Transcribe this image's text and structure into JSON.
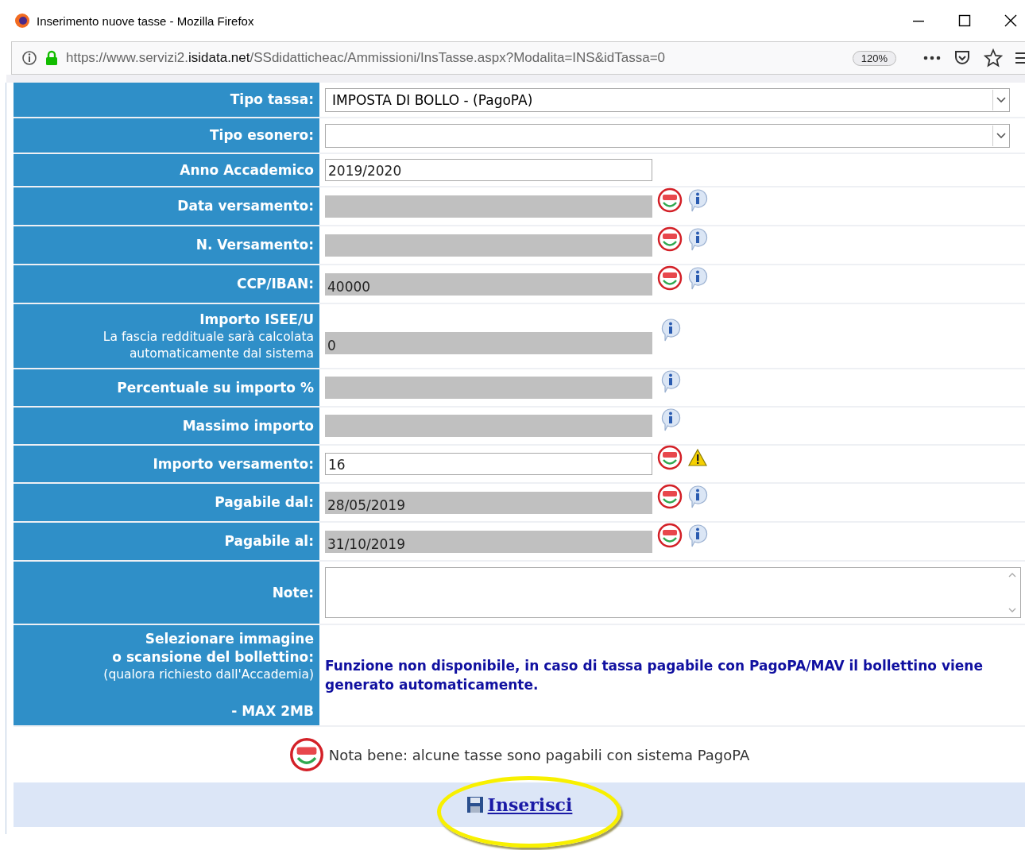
{
  "window": {
    "title": "Inserimento nuove tasse - Mozilla Firefox",
    "url_prefix": "https://www.servizi2.",
    "url_domain": "isidata.net",
    "url_path": "/SSdidatticheac/Ammissioni/InsTasse.aspx?Modalita=INS&idTassa=0",
    "zoom": "120%"
  },
  "form": {
    "rows": [
      {
        "label": "Tipo tassa:",
        "kind": "select",
        "value": "IMPOSTA DI BOLLO -  (PagoPA)",
        "icons": []
      },
      {
        "label": "Tipo esonero:",
        "kind": "select",
        "value": "",
        "icons": []
      },
      {
        "label": "Anno Accademico",
        "kind": "text",
        "value": "2019/2020",
        "icons": []
      },
      {
        "label": "Data versamento:",
        "kind": "readonly",
        "value": "",
        "icons": [
          {
            "kind": "pagopa"
          },
          {
            "kind": "info"
          }
        ]
      },
      {
        "label": "N. Versamento:",
        "kind": "readonly",
        "value": "",
        "icons": [
          {
            "kind": "pagopa"
          },
          {
            "kind": "info"
          }
        ]
      },
      {
        "label": "CCP/IBAN:",
        "kind": "readonly",
        "value": "40000",
        "icons": [
          {
            "kind": "pagopa"
          },
          {
            "kind": "info"
          }
        ]
      },
      {
        "label": "Importo ISEE/U",
        "note": "La fascia reddituale sarà calcolata automaticamente dal sistema",
        "kind": "readonly",
        "value": "0",
        "icons": [
          {
            "kind": "info"
          }
        ]
      },
      {
        "label": "Percentuale su importo %",
        "kind": "readonly",
        "value": "",
        "icons": [
          {
            "kind": "info"
          }
        ]
      },
      {
        "label": "Massimo importo",
        "kind": "readonly",
        "value": "",
        "icons": [
          {
            "kind": "info"
          }
        ]
      },
      {
        "label": "Importo versamento:",
        "kind": "text",
        "value": "16",
        "icons": [
          {
            "kind": "pagopa"
          },
          {
            "kind": "warning"
          }
        ]
      },
      {
        "label": "Pagabile dal:",
        "kind": "readonly",
        "value": "28/05/2019",
        "icons": [
          {
            "kind": "pagopa"
          },
          {
            "kind": "info"
          }
        ]
      },
      {
        "label": "Pagabile al:",
        "kind": "readonly",
        "value": "31/10/2019",
        "icons": [
          {
            "kind": "pagopa"
          },
          {
            "kind": "info"
          }
        ]
      },
      {
        "label": "Note:",
        "kind": "textarea",
        "value": "",
        "icons": []
      },
      {
        "label": "Selezionare immagine\no scansione del bollettino:",
        "note": "(qualora richiesto dall'Accademia)",
        "footer": "- MAX 2MB",
        "kind": "message",
        "value": "Funzione non disponibile, in caso di tassa pagabile con PagoPA/MAV il bollettino viene generato automaticamente.",
        "icons": []
      }
    ],
    "notice": "Nota bene: alcune tasse sono pagabili con sistema PagoPA",
    "submit": "Inserisci"
  }
}
